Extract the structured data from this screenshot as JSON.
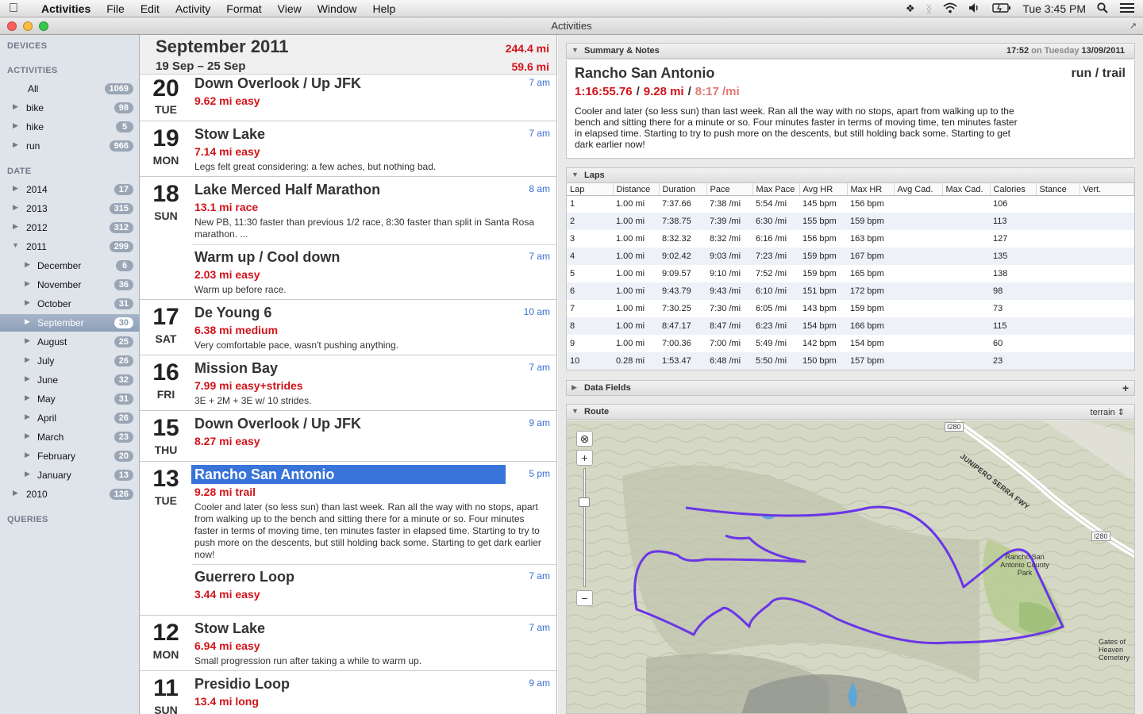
{
  "menubar": {
    "app_name": "Activities",
    "menus": [
      "File",
      "Edit",
      "Activity",
      "Format",
      "View",
      "Window",
      "Help"
    ],
    "clock": "Tue 3:45 PM"
  },
  "window": {
    "title": "Activities"
  },
  "sidebar": {
    "devices_heading": "DEVICES",
    "activities_heading": "ACTIVITIES",
    "activities": [
      {
        "label": "All",
        "count": "1069"
      },
      {
        "label": "bike",
        "count": "98"
      },
      {
        "label": "hike",
        "count": "5"
      },
      {
        "label": "run",
        "count": "966"
      }
    ],
    "date_heading": "DATE",
    "years": [
      {
        "label": "2014",
        "count": "17"
      },
      {
        "label": "2013",
        "count": "315"
      },
      {
        "label": "2012",
        "count": "312"
      },
      {
        "label": "2011",
        "count": "299"
      }
    ],
    "months": [
      {
        "label": "December",
        "count": "6"
      },
      {
        "label": "November",
        "count": "36"
      },
      {
        "label": "October",
        "count": "31"
      },
      {
        "label": "September",
        "count": "30"
      },
      {
        "label": "August",
        "count": "25"
      },
      {
        "label": "July",
        "count": "26"
      },
      {
        "label": "June",
        "count": "32"
      },
      {
        "label": "May",
        "count": "31"
      },
      {
        "label": "April",
        "count": "26"
      },
      {
        "label": "March",
        "count": "23"
      },
      {
        "label": "February",
        "count": "20"
      },
      {
        "label": "January",
        "count": "13"
      }
    ],
    "year_2010": {
      "label": "2010",
      "count": "126"
    },
    "queries_heading": "QUERIES"
  },
  "list": {
    "month_title": "September 2011",
    "month_total": "244.4 mi",
    "week_range": "19 Sep – 25 Sep",
    "week_total": "59.6 mi",
    "days": [
      {
        "num": "20",
        "dow": "TUE",
        "activities": [
          {
            "title": "Down Overlook / Up JFK",
            "time": "7 am",
            "sub": "9.62 mi easy",
            "note": ""
          }
        ]
      },
      {
        "num": "19",
        "dow": "MON",
        "activities": [
          {
            "title": "Stow Lake",
            "time": "7 am",
            "sub": "7.14 mi easy",
            "note": "Legs felt great considering: a few aches, but nothing bad."
          }
        ]
      },
      {
        "num": "18",
        "dow": "SUN",
        "activities": [
          {
            "title": "Lake Merced Half Marathon",
            "time": "8 am",
            "sub": "13.1 mi race",
            "note": "New PB, 11:30 faster than previous 1/2 race, 8:30 faster than split in Santa Rosa marathon. ..."
          },
          {
            "title": "Warm up / Cool down",
            "time": "7 am",
            "sub": "2.03 mi easy",
            "note": "Warm up before race."
          }
        ]
      },
      {
        "num": "17",
        "dow": "SAT",
        "activities": [
          {
            "title": "De Young 6",
            "time": "10 am",
            "sub": "6.38 mi medium",
            "note": "Very comfortable pace, wasn't pushing anything."
          }
        ]
      },
      {
        "num": "16",
        "dow": "FRI",
        "activities": [
          {
            "title": "Mission Bay",
            "time": "7 am",
            "sub": "7.99 mi easy+strides",
            "note": "3E + 2M + 3E w/ 10 strides."
          }
        ]
      },
      {
        "num": "15",
        "dow": "THU",
        "activities": [
          {
            "title": "Down Overlook / Up JFK",
            "time": "9 am",
            "sub": "8.27 mi easy",
            "note": ""
          }
        ]
      },
      {
        "num": "13",
        "dow": "TUE",
        "activities": [
          {
            "title": "Rancho San Antonio",
            "time": "5 pm",
            "sub": "9.28 mi trail",
            "note": "Cooler and later (so less sun) than last week. Ran all the way with no stops, apart from walking up to the bench and sitting there for a minute or so. Four minutes faster in terms of moving time, ten minutes faster in elapsed time. Starting to try to push more on the descents, but still holding back some. Starting to get dark earlier now!"
          },
          {
            "title": "Guerrero Loop",
            "time": "7 am",
            "sub": "3.44 mi easy",
            "note": ""
          }
        ]
      },
      {
        "num": "12",
        "dow": "MON",
        "activities": [
          {
            "title": "Stow Lake",
            "time": "7 am",
            "sub": "6.94 mi easy",
            "note": "Small progression run after taking a while to warm up."
          }
        ]
      },
      {
        "num": "11",
        "dow": "SUN",
        "activities": [
          {
            "title": "Presidio Loop",
            "time": "9 am",
            "sub": "13.4 mi long",
            "note": ""
          }
        ]
      }
    ]
  },
  "summary": {
    "heading": "Summary & Notes",
    "time": "17:52",
    "on_label": "on Tuesday",
    "date": "13/09/2011",
    "title": "Rancho San Antonio",
    "type": "run  /  trail",
    "duration": "1:16:55.76",
    "distance": "9.28 mi",
    "pace": "8:17 /mi",
    "notes": "Cooler and later (so less sun) than last week. Ran all the way with no stops, apart from walking up to the bench and sitting there for a minute or so. Four minutes faster in terms of moving time, ten minutes faster in elapsed time. Starting to try to push more on the descents, but still holding back some. Starting to get dark earlier now!"
  },
  "laps": {
    "heading": "Laps",
    "columns": [
      "Lap",
      "Distance",
      "Duration",
      "Pace",
      "Max Pace",
      "Avg HR",
      "Max HR",
      "Avg Cad.",
      "Max Cad.",
      "Calories",
      "Stance",
      "Vert."
    ],
    "rows": [
      [
        "1",
        "1.00 mi",
        "7:37.66",
        "7:38 /mi",
        "5:54 /mi",
        "145 bpm",
        "156 bpm",
        "",
        "",
        "106",
        "",
        ""
      ],
      [
        "2",
        "1.00 mi",
        "7:38.75",
        "7:39 /mi",
        "6:30 /mi",
        "155 bpm",
        "159 bpm",
        "",
        "",
        "113",
        "",
        ""
      ],
      [
        "3",
        "1.00 mi",
        "8:32.32",
        "8:32 /mi",
        "6:16 /mi",
        "156 bpm",
        "163 bpm",
        "",
        "",
        "127",
        "",
        ""
      ],
      [
        "4",
        "1.00 mi",
        "9:02.42",
        "9:03 /mi",
        "7:23 /mi",
        "159 bpm",
        "167 bpm",
        "",
        "",
        "135",
        "",
        ""
      ],
      [
        "5",
        "1.00 mi",
        "9:09.57",
        "9:10 /mi",
        "7:52 /mi",
        "159 bpm",
        "165 bpm",
        "",
        "",
        "138",
        "",
        ""
      ],
      [
        "6",
        "1.00 mi",
        "9:43.79",
        "9:43 /mi",
        "6:10 /mi",
        "151 bpm",
        "172 bpm",
        "",
        "",
        "98",
        "",
        ""
      ],
      [
        "7",
        "1.00 mi",
        "7:30.25",
        "7:30 /mi",
        "6:05 /mi",
        "143 bpm",
        "159 bpm",
        "",
        "",
        "73",
        "",
        ""
      ],
      [
        "8",
        "1.00 mi",
        "8:47.17",
        "8:47 /mi",
        "6:23 /mi",
        "154 bpm",
        "166 bpm",
        "",
        "",
        "115",
        "",
        ""
      ],
      [
        "9",
        "1.00 mi",
        "7:00.36",
        "7:00 /mi",
        "5:49 /mi",
        "142 bpm",
        "154 bpm",
        "",
        "",
        "60",
        "",
        ""
      ],
      [
        "10",
        "0.28 mi",
        "1:53.47",
        "6:48 /mi",
        "5:50 /mi",
        "150 bpm",
        "157 bpm",
        "",
        "",
        "23",
        "",
        ""
      ]
    ]
  },
  "data_fields": {
    "heading": "Data Fields",
    "add": "+"
  },
  "route": {
    "heading": "Route",
    "mode": "terrain",
    "map_labels": {
      "i280_top": "I280",
      "freeway": "JUNIPERO SERRA FWY",
      "i280_right": "I280",
      "park": "Rancho San Antonio County Park",
      "cemetery": "Gates of Heaven Cemetery"
    },
    "route_color": "#6a35e8"
  },
  "colors": {
    "accent_red": "#d0141a",
    "selection_blue": "#3874d9",
    "time_blue": "#3c6fd1"
  }
}
